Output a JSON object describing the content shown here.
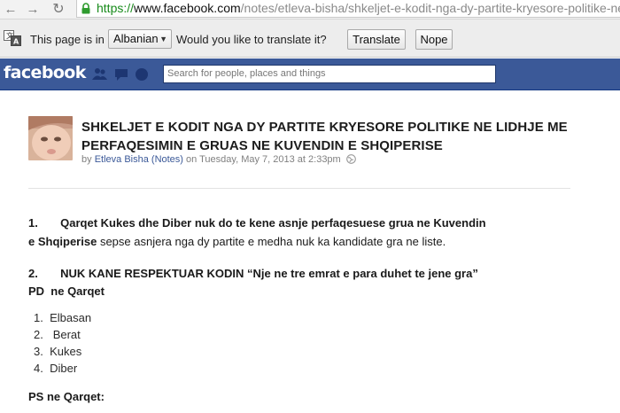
{
  "browser": {
    "url_scheme": "https://",
    "url_host": "www.facebook.com",
    "url_path": "/notes/etleva-bisha/shkeljet-e-kodit-nga-dy-partite-kryesore-politike-ne"
  },
  "translate_bar": {
    "prefix": "This page is in",
    "language": "Albanian",
    "question": "Would you like to translate it?",
    "translate_label": "Translate",
    "nope_label": "Nope"
  },
  "facebook": {
    "logo": "facebook",
    "search_placeholder": "Search for people, places and things",
    "brand_color": "#3b5998"
  },
  "note": {
    "title": "SHKELJET E KODIT NGA DY PARTITE KRYESORE POLITIKE NE LIDHJE ME PERFAQESIMIN E GRUAS NE KUVENDIN E SHQIPERISE",
    "by_prefix": "by",
    "author": "Etleva Bisha",
    "notes_label": "(Notes)",
    "date": "on Tuesday, May 7, 2013 at 2:33pm",
    "p1_num": "1.",
    "p1_bold": "Qarqet Kukes dhe Diber nuk do te kene asnje perfaqesuese grua ne Kuvendin e Shqiperise",
    "p1_rest": "sepse asnjera nga dy partite e medha nuk ka kandidate gra ne liste.",
    "p2_num": "2.",
    "p2_bold": "NUK KANE RESPEKTUAR KODIN “Nje ne tre emrat e para duhet te jene gra”",
    "p2_sub": "PD  ne Qarqet",
    "list": [
      {
        "num": "1.",
        "name": "Elbasan"
      },
      {
        "num": "2.",
        "name": "Berat"
      },
      {
        "num": "3.",
        "name": "Kukes"
      },
      {
        "num": "4.",
        "name": "Diber"
      }
    ],
    "ps_heading": "PS ne Qarqet:"
  }
}
